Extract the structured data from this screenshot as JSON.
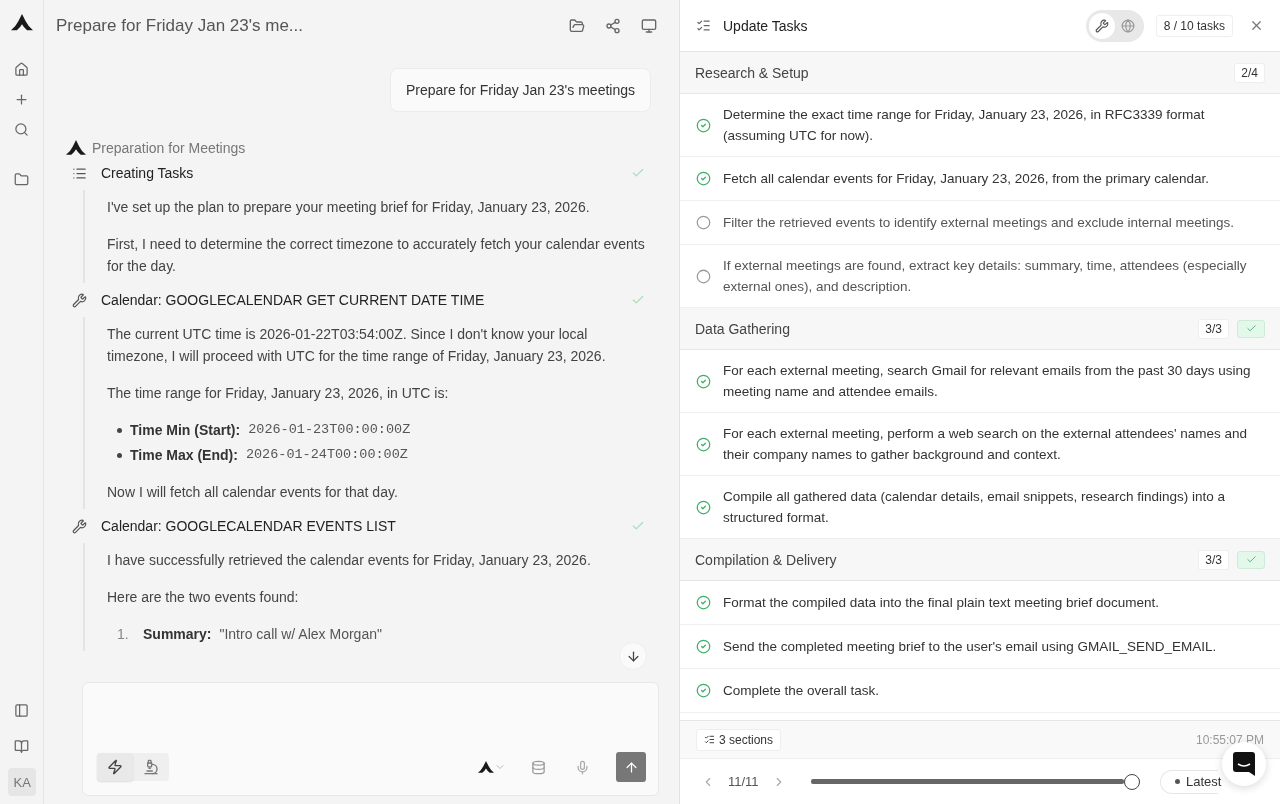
{
  "sidebar": {
    "user_initials": "KA"
  },
  "chat": {
    "title": "Prepare for Friday Jan 23's me...",
    "user_message": "Prepare for Friday Jan 23's meetings",
    "agent_name": "Preparation for Meetings",
    "steps": [
      {
        "kind": "plan",
        "label": "Creating Tasks",
        "done": true,
        "blocks": [
          {
            "kind": "p",
            "text": "I've set up the plan to prepare your meeting brief for Friday, January 23, 2026."
          },
          {
            "kind": "p",
            "text": "First, I need to determine the correct timezone to accurately fetch your calendar events for the day."
          }
        ]
      },
      {
        "kind": "tool",
        "label": "Calendar: GOOGLECALENDAR GET CURRENT DATE TIME",
        "done": true,
        "blocks": [
          {
            "kind": "p",
            "text": "The current UTC time is 2026-01-22T03:54:00Z. Since I don't know your local timezone, I will proceed with UTC for the time range of Friday, January 23, 2026."
          },
          {
            "kind": "p",
            "text": "The time range for Friday, January 23, 2026, in UTC is:"
          },
          {
            "kind": "bullets",
            "items": [
              {
                "label": "Time Min (Start):",
                "value": "2026-01-23T00:00:00Z"
              },
              {
                "label": "Time Max (End):",
                "value": "2026-01-24T00:00:00Z"
              }
            ]
          },
          {
            "kind": "p",
            "text": "Now I will fetch all calendar events for that day."
          }
        ]
      },
      {
        "kind": "tool",
        "label": "Calendar: GOOGLECALENDAR EVENTS LIST",
        "done": true,
        "blocks": [
          {
            "kind": "p",
            "text": "I have successfully retrieved the calendar events for Friday, January 23, 2026."
          },
          {
            "kind": "p",
            "text": "Here are the two events found:"
          },
          {
            "kind": "numbered",
            "items": [
              {
                "number": "1.",
                "label": "Summary:",
                "value": "\"Intro call w/ Alex Morgan\""
              }
            ]
          }
        ]
      }
    ],
    "composer": {
      "modes": [
        {
          "kind": "bolt",
          "selected": true
        },
        {
          "kind": "microscope",
          "selected": false
        }
      ]
    }
  },
  "tasks_panel": {
    "title": "Update Tasks",
    "tools": [
      {
        "kind": "wrench",
        "selected": true
      },
      {
        "kind": "globe",
        "selected": false
      }
    ],
    "count": "8 / 10 tasks",
    "sections": [
      {
        "title": "Research & Setup",
        "count": "2/4",
        "complete": false,
        "tasks": [
          {
            "text": "Determine the exact time range for Friday, January 23, 2026, in RFC3339 format (assuming UTC for now).",
            "done": true
          },
          {
            "text": "Fetch all calendar events for Friday, January 23, 2026, from the primary calendar.",
            "done": true
          },
          {
            "text": "Filter the retrieved events to identify external meetings and exclude internal meetings.",
            "done": false
          },
          {
            "text": "If external meetings are found, extract key details: summary, time, attendees (especially external ones), and description.",
            "done": false
          }
        ]
      },
      {
        "title": "Data Gathering",
        "count": "3/3",
        "complete": true,
        "tasks": [
          {
            "text": "For each external meeting, search Gmail for relevant emails from the past 30 days using meeting name and attendee emails.",
            "done": true
          },
          {
            "text": "For each external meeting, perform a web search on the external attendees' names and their company names to gather background and context.",
            "done": true
          },
          {
            "text": "Compile all gathered data (calendar details, email snippets, research findings) into a structured format.",
            "done": true
          }
        ]
      },
      {
        "title": "Compilation & Delivery",
        "count": "3/3",
        "complete": true,
        "tasks": [
          {
            "text": "Format the compiled data into the final plain text meeting brief document.",
            "done": true
          },
          {
            "text": "Send the completed meeting brief to the user's email using GMAIL_SEND_EMAIL.",
            "done": true
          },
          {
            "text": "Complete the overall task.",
            "done": true
          }
        ]
      }
    ],
    "sections_label": "3 sections",
    "timestamp": "10:55:07 PM",
    "pager": "11/11",
    "timeline": {
      "level": 1.0
    },
    "latest_label": "Latest"
  }
}
